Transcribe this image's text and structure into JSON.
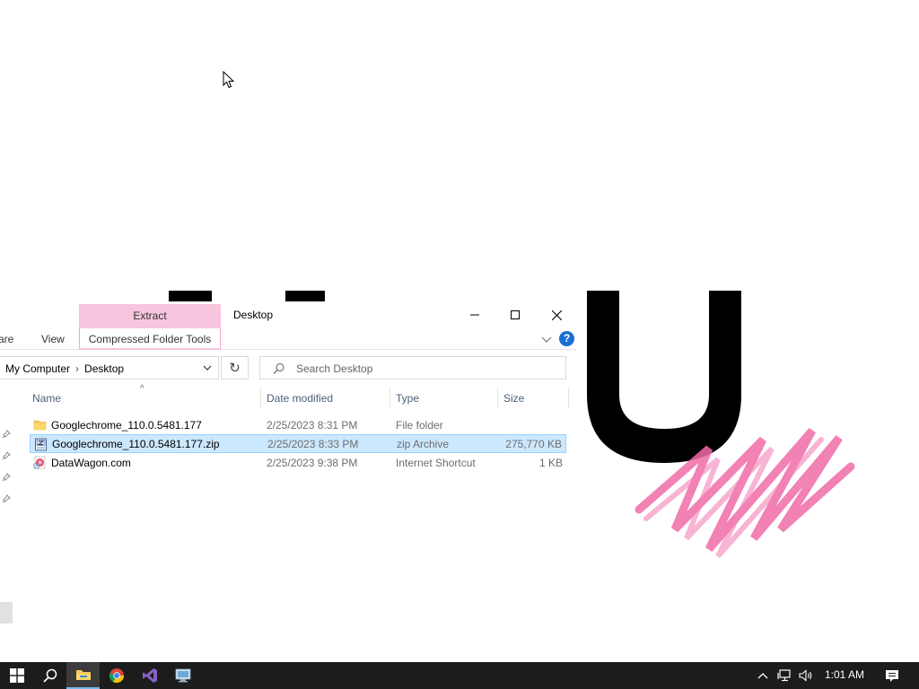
{
  "window": {
    "title": "Desktop",
    "context_tab": "Extract",
    "ribbon_tabs": {
      "share": "are",
      "view": "View",
      "compressed": "Compressed Folder Tools"
    }
  },
  "address": {
    "segments": [
      "My Computer",
      "Desktop"
    ]
  },
  "search": {
    "placeholder": "Search Desktop"
  },
  "columns": {
    "name": "Name",
    "date": "Date modified",
    "type": "Type",
    "size": "Size"
  },
  "files": [
    {
      "name": "Googlechrome_110.0.5481.177",
      "date": "2/25/2023 8:31 PM",
      "type": "File folder",
      "size": "",
      "icon": "folder-icon"
    },
    {
      "name": "Googlechrome_110.0.5481.177.zip",
      "date": "2/25/2023 8:33 PM",
      "type": "zip Archive",
      "size": "275,770 KB",
      "icon": "zip-archive-icon"
    },
    {
      "name": "DataWagon.com",
      "date": "2/25/2023 9:38 PM",
      "type": "Internet Shortcut",
      "size": "1 KB",
      "icon": "internet-shortcut-icon"
    }
  ],
  "taskbar": {
    "clock": "1:01 AM",
    "apps": [
      "start-icon",
      "search-icon",
      "file-explorer-icon",
      "chrome-icon",
      "visual-studio-icon",
      "remote-desktop-icon"
    ]
  },
  "colors": {
    "context_tab": "#f8c5de",
    "selection": "#cce8ff",
    "taskbar": "#1c1c1c",
    "help": "#1a6fd1",
    "wallpaper_scribble": "#f06ca8"
  }
}
